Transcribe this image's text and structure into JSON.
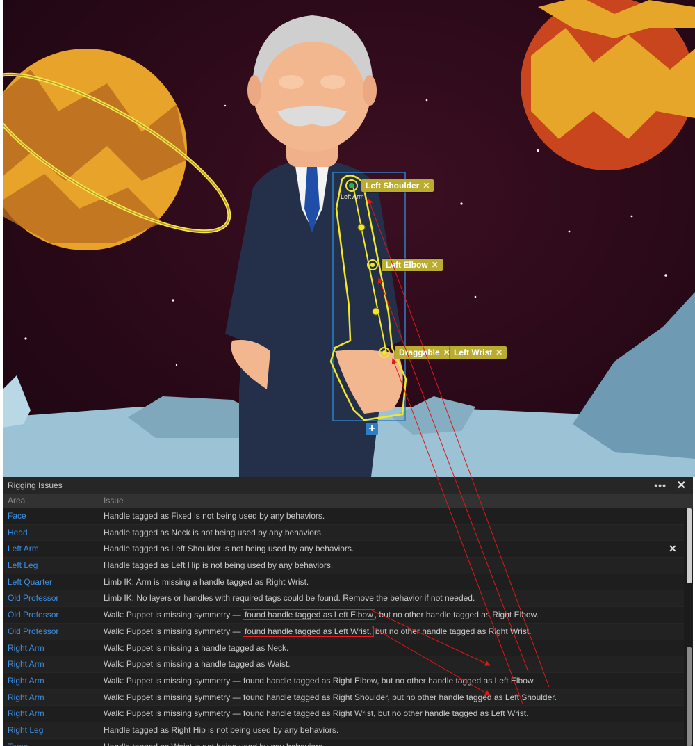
{
  "scene": {
    "labels": {
      "left_shoulder": "Left Shoulder",
      "left_arm": "Left Arm",
      "left_elbow": "Left Elbow",
      "draggable": "Draggable",
      "left_wrist": "Left Wrist"
    },
    "remove_glyph": "✕",
    "add_glyph": "+",
    "colors": {
      "tag": "#b9ac2f",
      "outline": "#f1e82a",
      "bounds": "#2e7fc1",
      "sky": "#2a0918"
    }
  },
  "panel": {
    "title": "Rigging Issues",
    "menu_glyph": "•••",
    "close_glyph": "✕",
    "columns": {
      "area": "Area",
      "issue": "Issue"
    },
    "rows": [
      {
        "area": "Face",
        "issue": "Handle tagged as Fixed is not being used by any behaviors."
      },
      {
        "area": "Head",
        "issue": "Handle tagged as Neck is not being used by any behaviors."
      },
      {
        "area": "Left Arm",
        "issue": "Handle tagged as Left Shoulder is not being used by any behaviors."
      },
      {
        "area": "Left Leg",
        "issue": "Handle tagged as Left Hip is not being used by any behaviors."
      },
      {
        "area": "Left Quarter",
        "issue": "Limb IK: Arm is missing a handle tagged as Right Wrist."
      },
      {
        "area": "Old Professor",
        "issue": "Limb IK: No layers or handles with required tags could be found. Remove the behavior if not needed."
      },
      {
        "area": "Old Professor",
        "issue_pre": "Walk: Puppet is missing symmetry — ",
        "issue_hl": "found handle tagged as Left Elbow",
        "issue_post": ", but no other handle tagged as Right Elbow."
      },
      {
        "area": "Old Professor",
        "issue_pre": "Walk: Puppet is missing symmetry — ",
        "issue_hl": "found handle tagged as Left Wrist,",
        "issue_post": " but no other handle tagged as Right Wrist."
      },
      {
        "area": "Right Arm",
        "issue": "Walk: Puppet is missing a handle tagged as Neck."
      },
      {
        "area": "Right Arm",
        "issue": "Walk: Puppet is missing a handle tagged as Waist."
      },
      {
        "area": "Right Arm",
        "issue": "Walk: Puppet is missing symmetry — found handle tagged as Right Elbow, but no other handle tagged as Left Elbow."
      },
      {
        "area": "Right Arm",
        "issue": "Walk: Puppet is missing symmetry — found handle tagged as Right Shoulder, but no other handle tagged as Left Shoulder."
      },
      {
        "area": "Right Arm",
        "issue": "Walk: Puppet is missing symmetry — found handle tagged as Right Wrist, but no other handle tagged as Left Wrist."
      },
      {
        "area": "Right Leg",
        "issue": "Handle tagged as Right Hip is not being used by any behaviors."
      },
      {
        "area": "Torso",
        "issue": "Handle tagged as Waist is not being used by any behaviors."
      }
    ]
  }
}
